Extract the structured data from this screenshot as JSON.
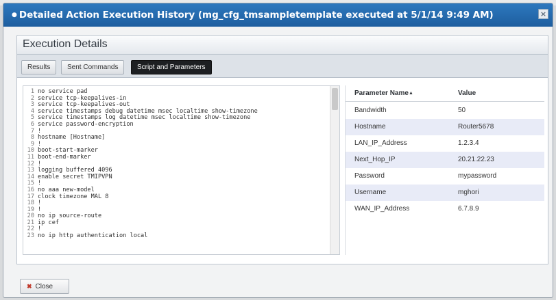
{
  "dialog": {
    "title": "Detailed Action Execution History (mg_cfg_tmsampletemplate executed at 5/1/14 9:49 AM)",
    "section_title": "Execution Details",
    "close_label": "Close"
  },
  "tabs": [
    {
      "label": "Results",
      "active": false
    },
    {
      "label": "Sent Commands",
      "active": false
    },
    {
      "label": "Script and Parameters",
      "active": true
    }
  ],
  "script_lines": [
    {
      "n": "1",
      "text": "no service pad"
    },
    {
      "n": "2",
      "text": "service tcp-keepalives-in"
    },
    {
      "n": "3",
      "text": "service tcp-keepalives-out"
    },
    {
      "n": "4",
      "text": "service timestamps debug datetime msec localtime show-timezone"
    },
    {
      "n": "5",
      "text": "service timestamps log datetime msec localtime show-timezone"
    },
    {
      "n": "6",
      "text": "service password-encryption"
    },
    {
      "n": "7",
      "text": "!"
    },
    {
      "n": "8",
      "text": "hostname [Hostname]"
    },
    {
      "n": "9",
      "text": "!"
    },
    {
      "n": "10",
      "text": "boot-start-marker"
    },
    {
      "n": "11",
      "text": "boot-end-marker"
    },
    {
      "n": "12",
      "text": "!"
    },
    {
      "n": "13",
      "text": "logging buffered 4096"
    },
    {
      "n": "14",
      "text": "enable secret TMIPVPN"
    },
    {
      "n": "15",
      "text": "!"
    },
    {
      "n": "16",
      "text": "no aaa new-model"
    },
    {
      "n": "17",
      "text": "clock timezone MAL 8"
    },
    {
      "n": "18",
      "text": "!"
    },
    {
      "n": "19",
      "text": "!"
    },
    {
      "n": "20",
      "text": "no ip source-route"
    },
    {
      "n": "21",
      "text": "ip cef"
    },
    {
      "n": "22",
      "text": "!"
    },
    {
      "n": "23",
      "text": "no ip http authentication local"
    }
  ],
  "params": {
    "col_name": "Parameter Name",
    "col_value": "Value",
    "sort_indicator": "▲",
    "rows": [
      {
        "name": "Bandwidth",
        "value": "50"
      },
      {
        "name": "Hostname",
        "value": "Router5678"
      },
      {
        "name": "LAN_IP_Address",
        "value": "1.2.3.4"
      },
      {
        "name": "Next_Hop_IP",
        "value": "20.21.22.23"
      },
      {
        "name": "Password",
        "value": "mypassword"
      },
      {
        "name": "Username",
        "value": "mghori"
      },
      {
        "name": "WAN_IP_Address",
        "value": "6.7.8.9"
      }
    ]
  },
  "colors": {
    "titlebar": "#1e5e9f",
    "active_tab": "#1d1f22",
    "alt_row": "#e8ebf7"
  }
}
